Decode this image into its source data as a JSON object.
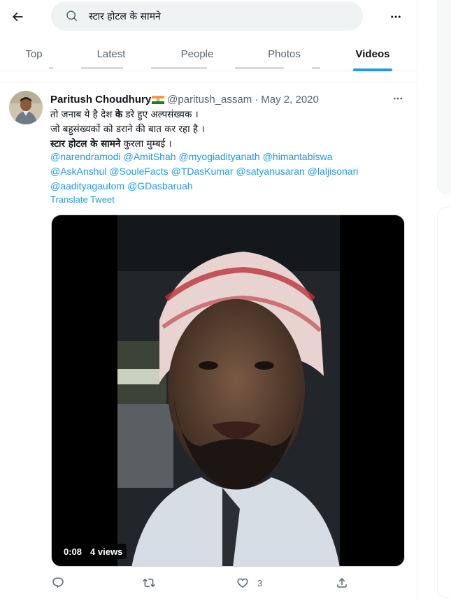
{
  "search": {
    "query": "स्टार होटल के सामने"
  },
  "tabs": [
    {
      "label": "Top",
      "active": false
    },
    {
      "label": "Latest",
      "active": false
    },
    {
      "label": "People",
      "active": false
    },
    {
      "label": "Photos",
      "active": false
    },
    {
      "label": "Videos",
      "active": true
    }
  ],
  "tweet": {
    "display_name": "Paritush Choudhury",
    "handle": "@paritush_assam",
    "separator": "·",
    "date": "May 2, 2020",
    "text_line1_a": "तो जनाब ये है देश ",
    "text_line1_bold": "के",
    "text_line1_b": " डरे हुए अल्पसंख्यक ।",
    "text_line2": "जो बहुसंख्यकों को डराने की बात कर रहा है ।",
    "text_line3_bold": "स्टार होटल के सामने",
    "text_line3_b": " कुरला मुम्बई ।",
    "mentions": [
      "@narendramodi",
      "@AmitShah",
      "@myogiadityanath",
      "@himantabiswa",
      "@AskAnshul",
      "@SouleFacts",
      "@TDasKumar",
      "@satyanusaran",
      "@laljisonari",
      "@aadityagautom",
      "@GDasbaruah"
    ],
    "translate_label": "Translate Tweet",
    "video": {
      "duration": "0:08",
      "views": "4 views"
    },
    "actions": {
      "reply_count": "",
      "retweet_count": "",
      "like_count": "3"
    }
  },
  "icons": {
    "back": "arrow-left-icon",
    "search": "search-icon",
    "more": "more-horizontal-icon",
    "reply": "reply-icon",
    "retweet": "retweet-icon",
    "like": "heart-icon",
    "share": "share-icon"
  },
  "colors": {
    "accent": "#1d9bf0",
    "secondary_text": "#536471",
    "search_bg": "#eff3f4"
  }
}
